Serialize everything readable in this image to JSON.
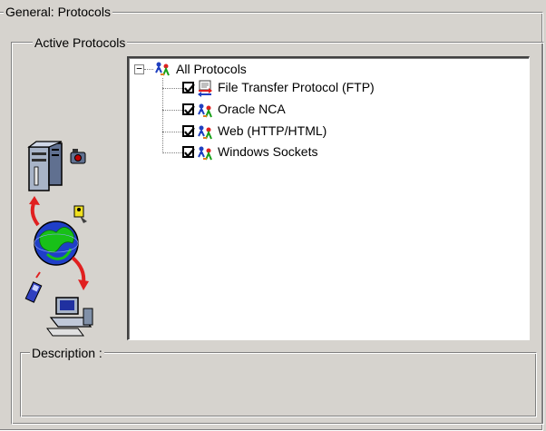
{
  "general_group": {
    "title": "General: Protocols"
  },
  "active_group": {
    "title": "Active Protocols"
  },
  "description_group": {
    "title": "Description :",
    "text": ""
  },
  "tree": {
    "root": {
      "label": "All Protocols",
      "icon": "protocols-icon",
      "expanded": true
    },
    "items": [
      {
        "label": "File Transfer Protocol (FTP)",
        "checked": true,
        "icon": "ftp-icon"
      },
      {
        "label": "Oracle NCA",
        "checked": true,
        "icon": "protocol-people-icon"
      },
      {
        "label": "Web (HTTP/HTML)",
        "checked": true,
        "icon": "protocol-people-icon"
      },
      {
        "label": "Windows Sockets",
        "checked": true,
        "icon": "protocol-people-icon"
      }
    ]
  },
  "colors": {
    "dialog_bg": "#d6d3ce",
    "tree_bg": "#ffffff",
    "arrow_red": "#e02020",
    "globe_blue": "#1f3fc8",
    "globe_green": "#18c018"
  }
}
